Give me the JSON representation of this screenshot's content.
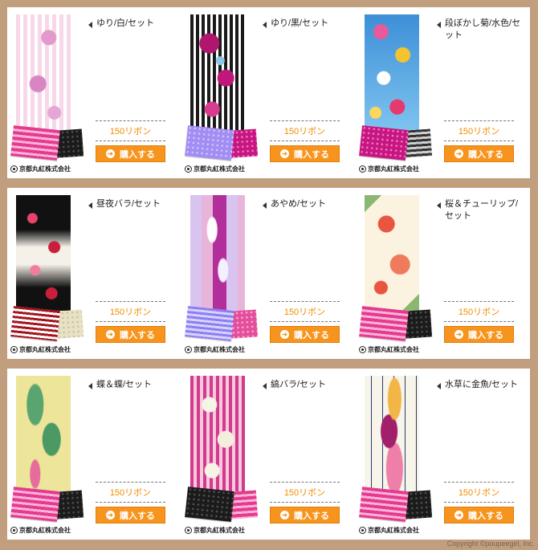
{
  "rows": [
    {
      "items": [
        {
          "title": "ゆり/白/セット",
          "price": "150リボン",
          "buy_label": "購入する",
          "pattern": "yuri-white",
          "swatch_a": "pink-stripe",
          "swatch_b": "black-dots"
        },
        {
          "title": "ゆり/黒/セット",
          "price": "150リボン",
          "buy_label": "購入する",
          "pattern": "yuri-black",
          "swatch_a": "lilac-dots",
          "swatch_b": "magenta-dots"
        },
        {
          "title": "段ぼかし菊/水色/セット",
          "price": "150リボン",
          "buy_label": "購入する",
          "pattern": "kiku",
          "swatch_a": "magenta-dots",
          "swatch_b": "gray-stripe"
        }
      ]
    },
    {
      "items": [
        {
          "title": "昼夜バラ/セット",
          "price": "150リボン",
          "buy_label": "購入する",
          "pattern": "hiyoru",
          "swatch_a": "red-stripe",
          "swatch_b": "cream-dots"
        },
        {
          "title": "あやめ/セット",
          "price": "150リボン",
          "buy_label": "購入する",
          "pattern": "ayame",
          "swatch_a": "blue-stripe",
          "swatch_b": "pink-dots"
        },
        {
          "title": "桜＆チューリップ/セット",
          "price": "150リボン",
          "buy_label": "購入する",
          "pattern": "sakura",
          "swatch_a": "pink-stripe",
          "swatch_b": "black-dots"
        }
      ]
    },
    {
      "items": [
        {
          "title": "蝶＆蝶/セット",
          "price": "150リボン",
          "buy_label": "購入する",
          "pattern": "chou",
          "swatch_a": "pink-stripe",
          "swatch_b": "black-dots"
        },
        {
          "title": "縞バラ/セット",
          "price": "150リボン",
          "buy_label": "購入する",
          "pattern": "shima-bara",
          "swatch_a": "black-dots",
          "swatch_b": "pink-stripe"
        },
        {
          "title": "水草に金魚/セット",
          "price": "150リボン",
          "buy_label": "購入する",
          "pattern": "kingyo",
          "swatch_a": "pink-stripe",
          "swatch_b": "black-dots"
        }
      ]
    }
  ],
  "maker": "京都丸紅株式会社",
  "copyright": "Copyright ©poupeegirl, Inc.",
  "colors": {
    "page_bg": "#c19f7e",
    "price": "#f08c00",
    "button": "#f7941d"
  },
  "icons": {
    "title_marker": "left-triangle-icon",
    "buy": "arrow-circle-icon",
    "maker": "maker-logo-icon"
  }
}
